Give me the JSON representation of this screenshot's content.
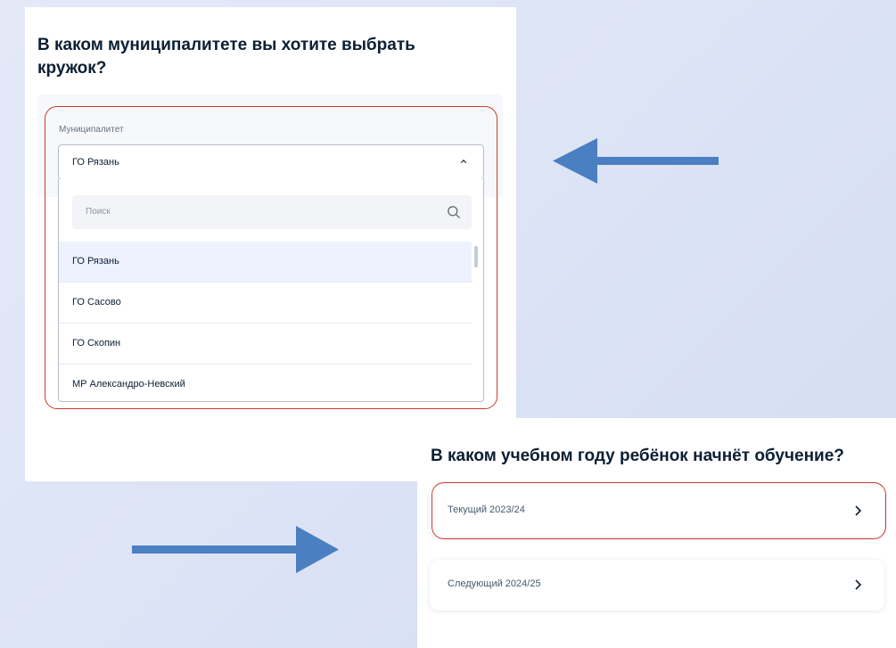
{
  "municipality_question": {
    "title": "В каком муниципалитете вы хотите выбрать кружок?",
    "field_label": "Муниципалитет",
    "selected_value": "ГО Рязань",
    "search_placeholder": "Поиск",
    "options": [
      "ГО Рязань",
      "ГО Сасово",
      "ГО Скопин",
      "МР Александро-Невский"
    ],
    "selected_index": 0
  },
  "year_question": {
    "title": "В каком учебном году ребёнок начнёт обучение?",
    "options": [
      {
        "label": "Текущий 2023/24",
        "highlighted": true
      },
      {
        "label": "Следующий 2024/25",
        "highlighted": false
      }
    ]
  },
  "colors": {
    "highlight_outline": "#d0392b",
    "arrow": "#4a7fc1",
    "selected_row": "#edf2fe"
  },
  "icons": [
    "chevron-up-icon",
    "search-icon",
    "chevron-right-icon",
    "arrow-left-icon",
    "arrow-right-icon"
  ]
}
